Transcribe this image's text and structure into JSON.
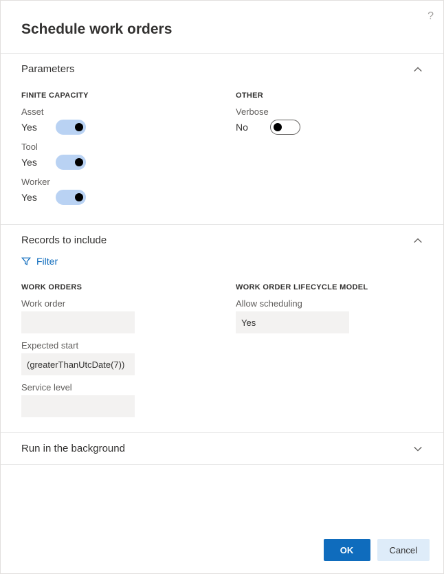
{
  "dialog": {
    "title": "Schedule work orders",
    "help_tooltip": "?"
  },
  "sections": {
    "parameters": {
      "title": "Parameters",
      "expanded": true,
      "finite_capacity": {
        "group_label": "FINITE CAPACITY",
        "asset": {
          "label": "Asset",
          "value_text": "Yes",
          "on": true
        },
        "tool": {
          "label": "Tool",
          "value_text": "Yes",
          "on": true
        },
        "worker": {
          "label": "Worker",
          "value_text": "Yes",
          "on": true
        }
      },
      "other": {
        "group_label": "OTHER",
        "verbose": {
          "label": "Verbose",
          "value_text": "No",
          "on": false
        }
      }
    },
    "records": {
      "title": "Records to include",
      "expanded": true,
      "filter_label": "Filter",
      "work_orders": {
        "group_label": "WORK ORDERS",
        "work_order": {
          "label": "Work order",
          "value": ""
        },
        "expected_start": {
          "label": "Expected start",
          "value": "(greaterThanUtcDate(7))"
        },
        "service_level": {
          "label": "Service level",
          "value": ""
        }
      },
      "lifecycle": {
        "group_label": "WORK ORDER LIFECYCLE MODEL",
        "allow_scheduling": {
          "label": "Allow scheduling",
          "value": "Yes"
        }
      }
    },
    "background": {
      "title": "Run in the background",
      "expanded": false
    }
  },
  "footer": {
    "ok": "OK",
    "cancel": "Cancel"
  }
}
